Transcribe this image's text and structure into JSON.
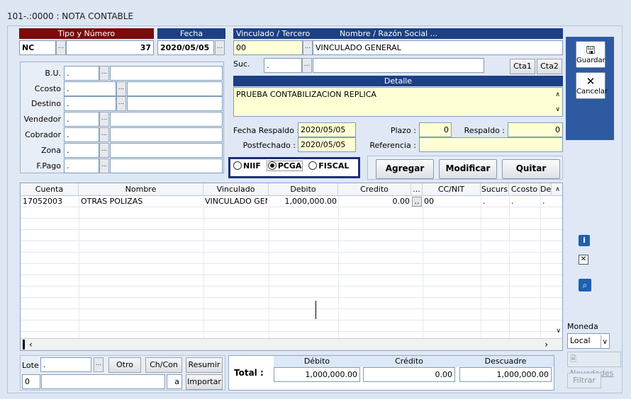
{
  "window": {
    "title": "101-.:0000 : NOTA CONTABLE"
  },
  "tipo": {
    "header": "Tipo y Número",
    "code": "NC",
    "number": "37"
  },
  "fecha": {
    "header": "Fecha",
    "value": "2020/05/05"
  },
  "vinculado": {
    "header": "Vinculado / Tercero",
    "code": "00",
    "name_header": "Nombre / Razón Social ...",
    "name": "VINCULADO GENERAL"
  },
  "suc": {
    "label": "Suc.",
    "value": "."
  },
  "cta_buttons": [
    "Cta1",
    "Cta2"
  ],
  "detalle": {
    "header": "Detalle",
    "text": "PRUEBA CONTABILIZACION REPLICA"
  },
  "fields": [
    {
      "label": "B.U.",
      "value": "."
    },
    {
      "label": "Ccosto",
      "value": "."
    },
    {
      "label": "Destino",
      "value": "."
    },
    {
      "label": "Vendedor",
      "value": "."
    },
    {
      "label": "Cobrador",
      "value": "."
    },
    {
      "label": "Zona",
      "value": "."
    },
    {
      "label": "F.Pago",
      "value": "."
    }
  ],
  "fecha_respaldo": {
    "label": "Fecha Respaldo :",
    "value": "2020/05/05"
  },
  "postfechado": {
    "label": "Postfechado :",
    "value": "2020/05/05"
  },
  "plazo": {
    "label": "Plazo :",
    "value": "0"
  },
  "respaldo": {
    "label": "Respaldo :",
    "value": "0"
  },
  "referencia": {
    "label": "Referencia :",
    "value": ""
  },
  "norma": {
    "options": [
      "NIIF",
      "PCGA",
      "FISCAL"
    ],
    "selected": "PCGA"
  },
  "actions": {
    "agregar": "Agregar",
    "modificar": "Modificar",
    "quitar": "Quitar"
  },
  "toolbar": {
    "guardar": "Guardar",
    "cancelar": "Cancelar"
  },
  "grid": {
    "columns": [
      "Cuenta",
      "Nombre",
      "Vinculado",
      "Debito",
      "Credito",
      "...",
      "CC/NIT",
      "Sucurs",
      "Ccosto",
      "De"
    ],
    "rows": [
      {
        "cuenta": "17052003",
        "nombre": "OTRAS POLIZAS",
        "vinculado": "VINCULADO GENE",
        "debito": "1,000,000.00",
        "credito": "0.00",
        "btn": "..",
        "ccnit": "00",
        "sucurs": ".",
        "ccosto": ".",
        "de": "."
      }
    ]
  },
  "moneda": {
    "label": "Moneda",
    "value": "Local"
  },
  "side_links": {
    "novedades": "Novedades",
    "filtrar": "Filtrar"
  },
  "bottom": {
    "lote_label": "Lote",
    "lote_value": ".",
    "lote_num": "0",
    "lote_a": "a",
    "otro": "Otro",
    "chcon": "Ch/Con",
    "resumir": "Resumir",
    "importar": "Importar"
  },
  "totals": {
    "label": "Total :",
    "debito_header": "Débito",
    "credito_header": "Crédito",
    "descuadre_header": "Descuadre",
    "debito": "1,000,000.00",
    "credito": "0.00",
    "descuadre": "1,000,000.00"
  }
}
